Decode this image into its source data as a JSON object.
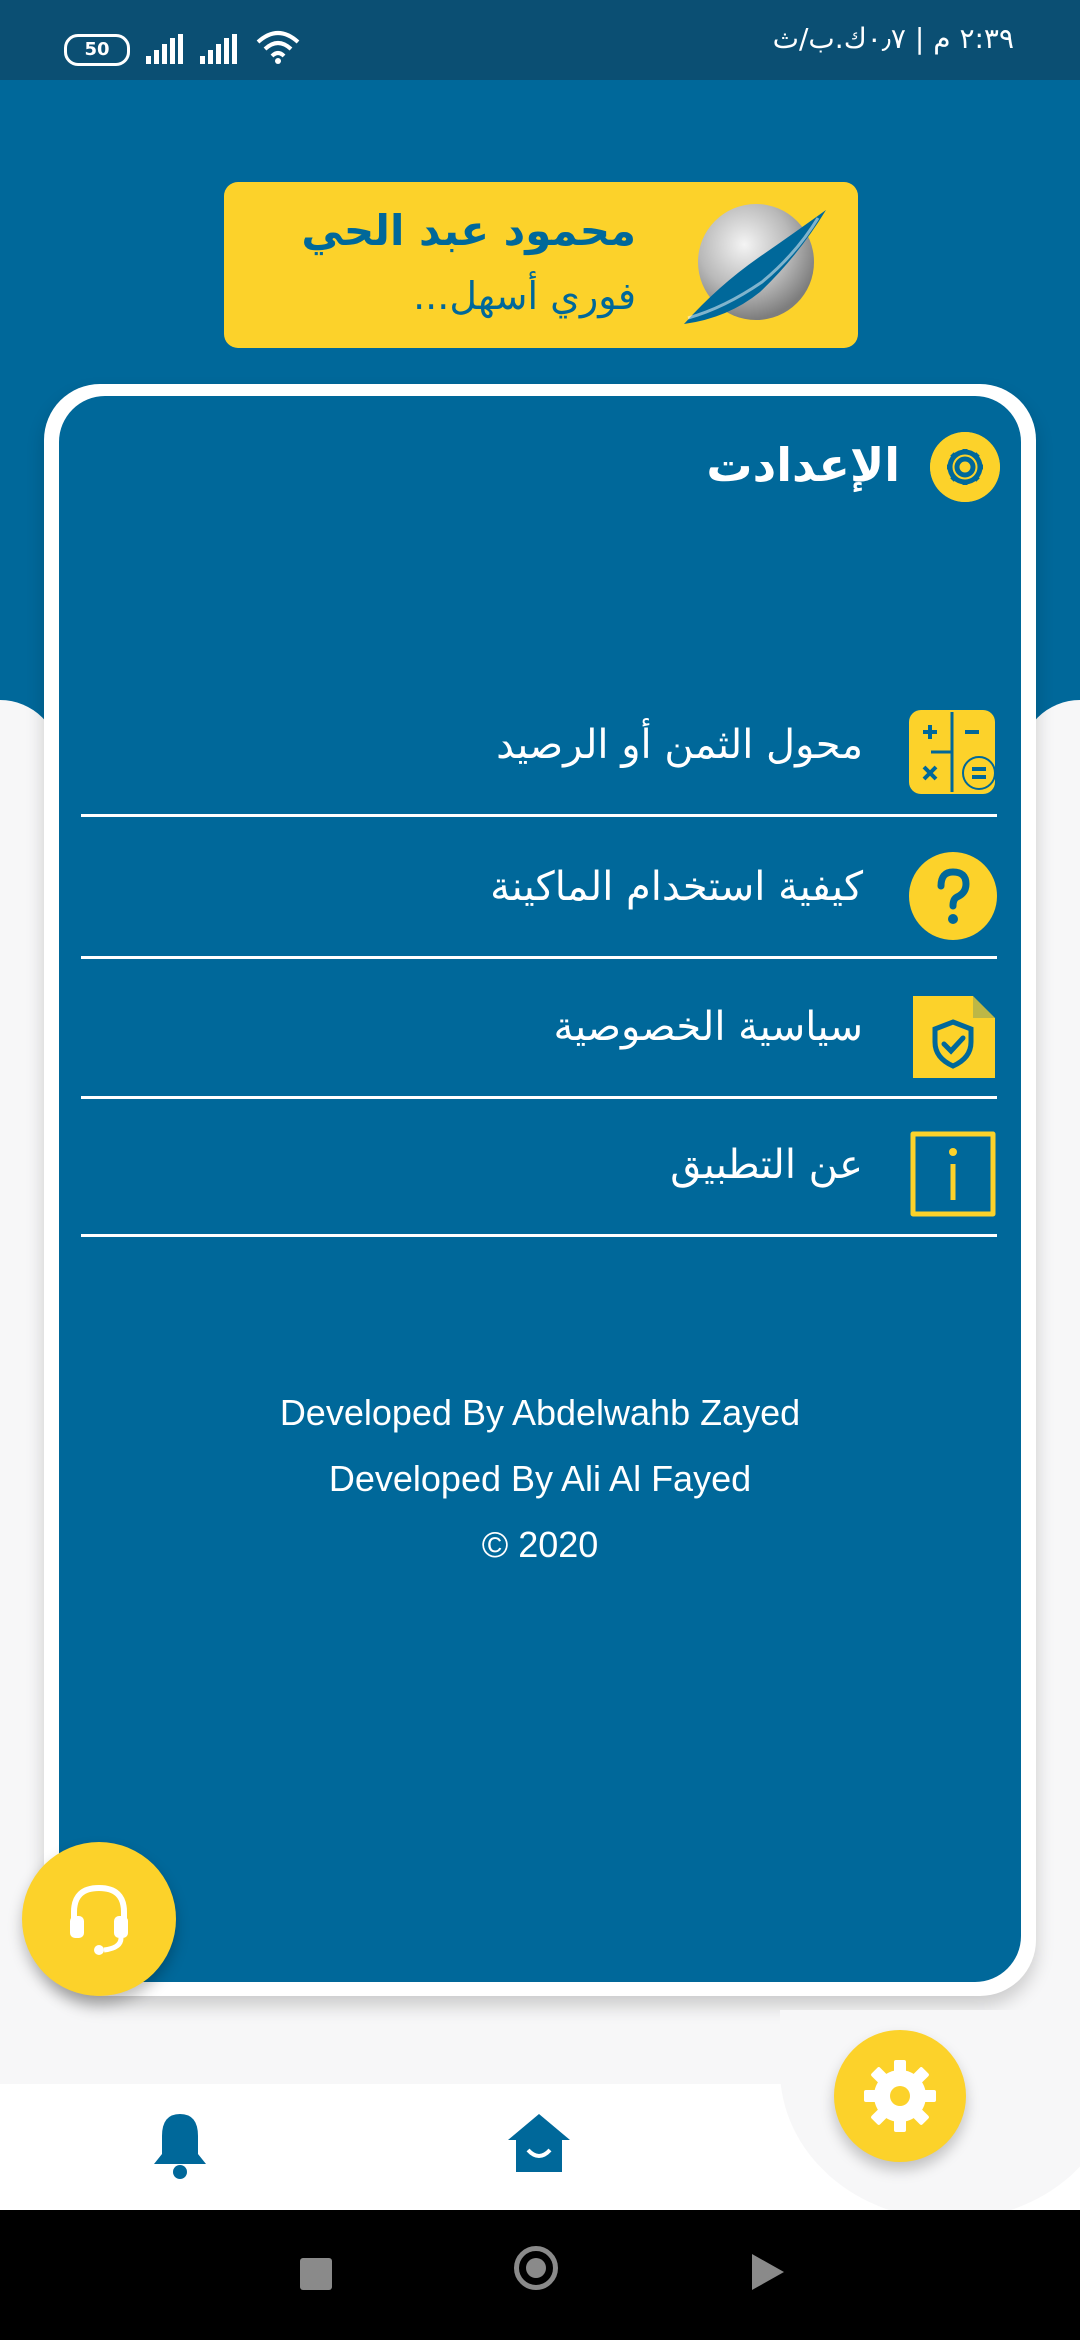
{
  "status_bar": {
    "time": "٢:٣٩ م | ٠٫٧ك.ب/ث",
    "battery": "50",
    "signal_icons": [
      "signal-icon",
      "signal-icon",
      "wifi-icon"
    ]
  },
  "brand": {
    "name": "محمود عبد الحي",
    "slogan": "فوري أسهل..."
  },
  "settings": {
    "title": "الإعدادت",
    "menu": [
      {
        "label": "محول الثمن أو الرصيد",
        "icon": "calculator-icon"
      },
      {
        "label": "كيفية استخدام الماكينة",
        "icon": "question-icon"
      },
      {
        "label": "سياسية الخصوصية",
        "icon": "privacy-shield-icon"
      },
      {
        "label": "عن التطبيق",
        "icon": "info-icon"
      }
    ]
  },
  "credits": {
    "line1": "Developed By Abdelwahb Zayed",
    "line2": "Developed By Ali Al Fayed",
    "line3": "© 2020"
  },
  "bottom_nav": {
    "items": [
      "bell-icon",
      "home-icon",
      "gear-icon"
    ],
    "active": "gear-icon"
  },
  "colors": {
    "primary": "#00689a",
    "accent": "#fcd22a",
    "status_bar": "#0b4f73"
  }
}
